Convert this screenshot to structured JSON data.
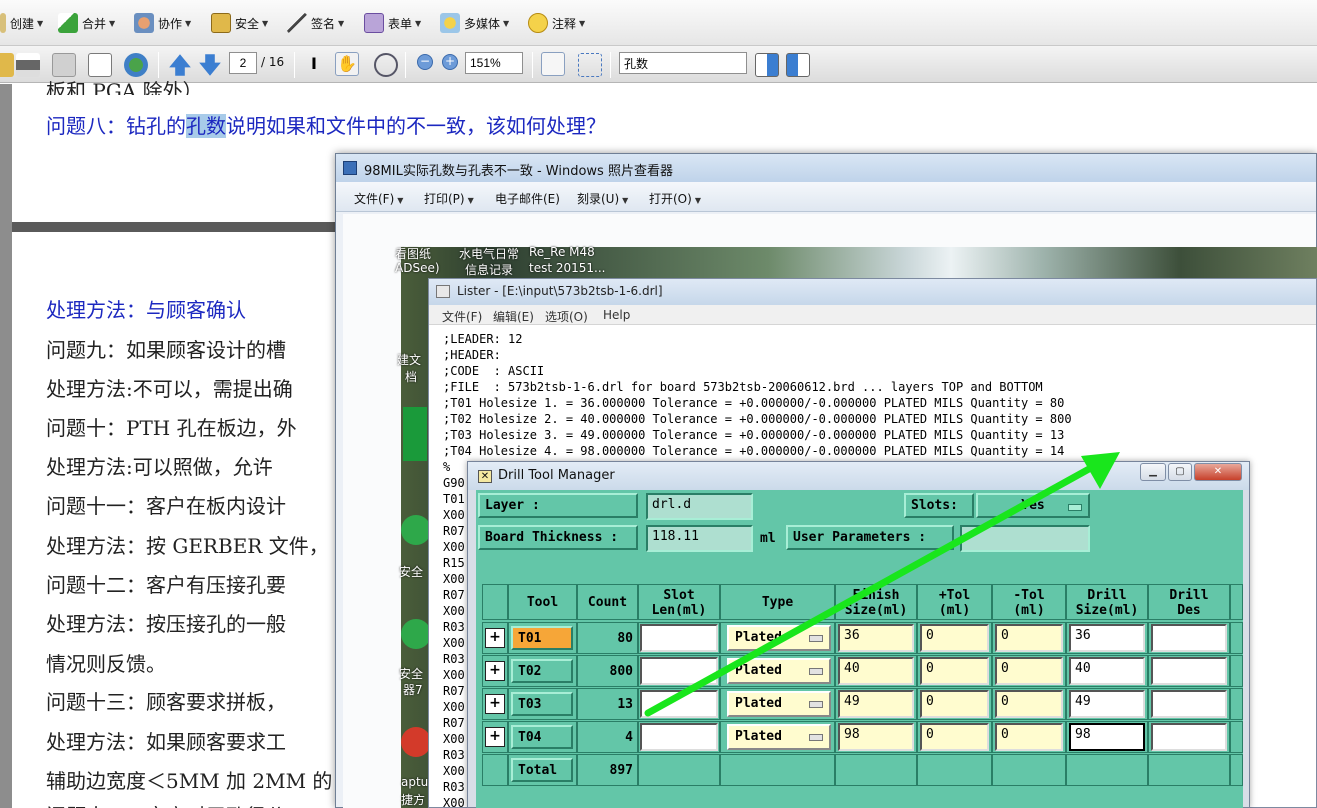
{
  "toolbar1": {
    "items": [
      {
        "label": "创建"
      },
      {
        "label": "合并"
      },
      {
        "label": "协作"
      },
      {
        "label": "安全"
      },
      {
        "label": "签名"
      },
      {
        "label": "表单"
      },
      {
        "label": "多媒体"
      },
      {
        "label": "注释"
      }
    ]
  },
  "toolbar2": {
    "page_current": "2",
    "page_total": "/ 16",
    "zoom": "151%",
    "search": "孔数"
  },
  "pdf": {
    "line0": "板和 PGA 除外）",
    "line1_pre": "问题八：钻孔的",
    "line1_hl": "孔数",
    "line1_post": "说明如果和文件中的不一致，该如何处理？",
    "lines": [
      "处理方法：与顾客确认",
      "问题九：如果顾客设计的槽",
      "处理方法:不可以，需提出确",
      "问题十：PTH 孔在板边，外",
      "处理方法:可以照做，允许",
      "问题十一：客户在板内设计",
      "处理方法：按 GERBER 文件，",
      "问题十二：客户有压接孔要",
      "处理方法：按压接孔的一般",
      "情况则反馈。",
      "问题十三：顾客要求拼板，",
      "处理方法：如果顾客要求工",
      "辅助边宽度＜5MM 加 2MM 的",
      "问题十四：客户对于孔径公"
    ]
  },
  "photo_viewer": {
    "title": "98MIL实际孔数与孔表不一致 - Windows 照片查看器",
    "menu": [
      "文件(F)",
      "打印(P)",
      "电子邮件(E)",
      "刻录(U)",
      "打开(O)"
    ]
  },
  "desktop": {
    "labels": [
      "看图纸",
      "水电气日常",
      "Re_Re M48",
      "ADSee)",
      "信息记录",
      "test 20151...",
      "建文",
      "档",
      "安全",
      "安全",
      "器7",
      "aptu",
      "捷方"
    ]
  },
  "lister": {
    "title": "Lister - [E:\\input\\573b2tsb-1-6.drl]",
    "menu": [
      "文件(F)",
      "编辑(E)",
      "选项(O)",
      "Help"
    ],
    "lines": [
      ";LEADER: 12",
      ";HEADER:",
      ";CODE  : ASCII",
      ";FILE  : 573b2tsb-1-6.drl for board 573b2tsb-20060612.brd ... layers TOP and BOTTOM",
      ";T01 Holesize 1. = 36.000000 Tolerance = +0.000000/-0.000000 PLATED MILS Quantity = 80",
      ";T02 Holesize 2. = 40.000000 Tolerance = +0.000000/-0.000000 PLATED MILS Quantity = 800",
      ";T03 Holesize 3. = 49.000000 Tolerance = +0.000000/-0.000000 PLATED MILS Quantity = 13",
      ";T04 Holesize 4. = 98.000000 Tolerance = +0.000000/-0.000000 PLATED MILS Quantity = 14",
      "%",
      "G90",
      "T01",
      "X00",
      "R07",
      "X00",
      "R15",
      "X00",
      "R07",
      "X00",
      "R03",
      "X00",
      "R03",
      "X00",
      "R07",
      "X00",
      "R07",
      "X00",
      "R03",
      "X00",
      "R03",
      "X00"
    ]
  },
  "drill_tool_manager": {
    "title": "Drill Tool Manager",
    "layer_label": "Layer          :",
    "layer_value": "drl.d",
    "slots_label": "Slots:",
    "slots_value": "Yes",
    "thickness_label": "Board Thickness :",
    "thickness_value": "118.11",
    "thickness_unit": "ml",
    "user_params_label": "User Parameters :",
    "headers": [
      "Tool",
      "Count",
      "Slot\nLen(ml)",
      "Type",
      "Finish\nSize(ml)",
      "+Tol\n(ml)",
      "-Tol\n(ml)",
      "Drill\nSize(ml)",
      "Drill\nDes"
    ],
    "rows": [
      {
        "tool": "T01",
        "count": "80",
        "type": "Plated",
        "finish": "36",
        "ptol": "0",
        "mtol": "0",
        "drill": "36"
      },
      {
        "tool": "T02",
        "count": "800",
        "type": "Plated",
        "finish": "40",
        "ptol": "0",
        "mtol": "0",
        "drill": "40"
      },
      {
        "tool": "T03",
        "count": "13",
        "type": "Plated",
        "finish": "49",
        "ptol": "0",
        "mtol": "0",
        "drill": "49"
      },
      {
        "tool": "T04",
        "count": "4",
        "type": "Plated",
        "finish": "98",
        "ptol": "0",
        "mtol": "0",
        "drill": "98"
      }
    ],
    "total_label": "Total",
    "total_count": "897"
  },
  "colors": {
    "dialog_bg": "#63c6a8",
    "tool_selected": "#f6a638",
    "arrow": "#19e61c",
    "pdf_blue": "#1c28c0"
  }
}
